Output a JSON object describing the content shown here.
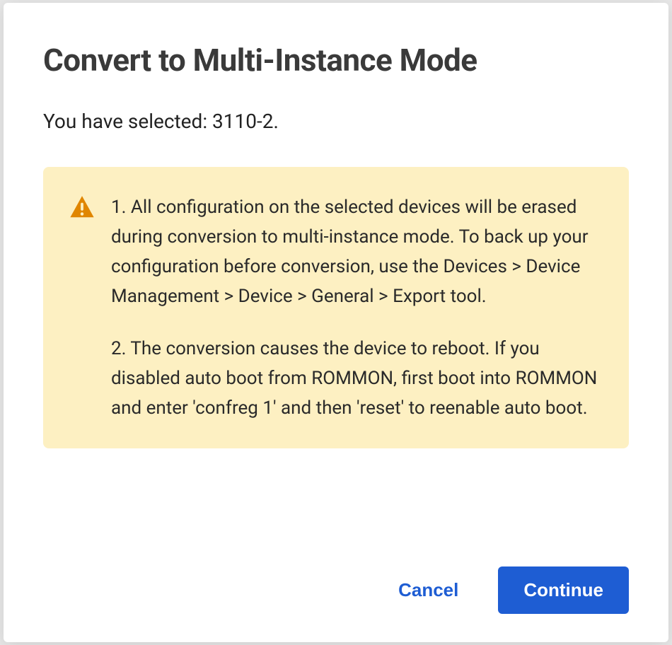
{
  "modal": {
    "title": "Convert to Multi-Instance Mode",
    "selected_prefix": "You have selected: ",
    "selected_device": "3110-2.",
    "warning": {
      "item1": "1. All configuration on the selected devices will be erased during conversion to multi-instance mode. To back up your configuration before conversion, use the Devices > Device Management > Device > General > Export tool.",
      "item2": "2. The conversion causes the device to reboot. If you disabled auto boot from ROMMON, first boot into ROMMON and enter 'confreg 1' and then 'reset' to reenable auto boot."
    },
    "footer": {
      "cancel_label": "Cancel",
      "continue_label": "Continue"
    }
  },
  "colors": {
    "primary": "#1e5dd3",
    "warning_bg": "#fdf0c2",
    "warning_icon": "#e08600"
  }
}
